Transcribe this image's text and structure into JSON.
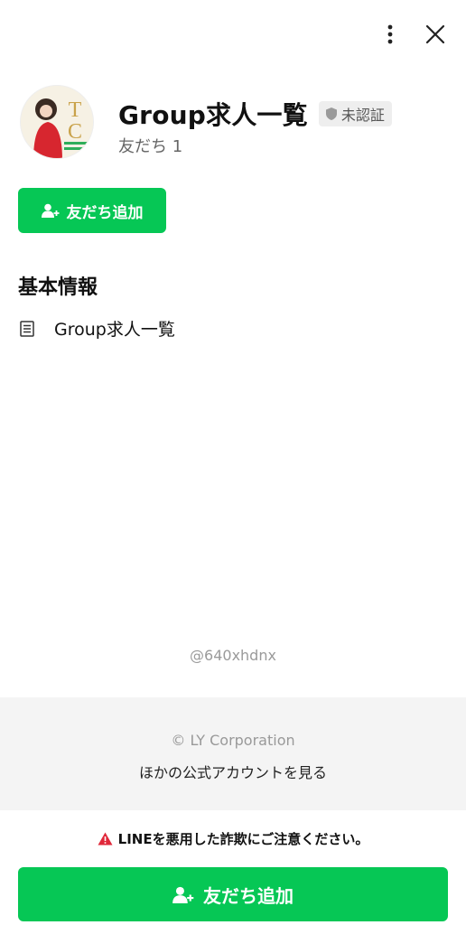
{
  "profile": {
    "name": "Group求人一覧",
    "verification_badge": "未認証",
    "friends_label": "友だち 1",
    "avatar_initials": "TC"
  },
  "actions": {
    "add_friend_label": "友だち追加"
  },
  "basic_info": {
    "title": "基本情報",
    "items": [
      {
        "icon": "document-icon",
        "text": "Group求人一覧"
      }
    ]
  },
  "account_id": "@640xhdnx",
  "footer": {
    "copyright": "© LY Corporation",
    "other_accounts": "ほかの公式アカウントを見る",
    "warning": "LINEを悪用した詐欺にご注意ください。"
  },
  "colors": {
    "accent": "#06c755",
    "warning_icon": "#e0283a"
  }
}
